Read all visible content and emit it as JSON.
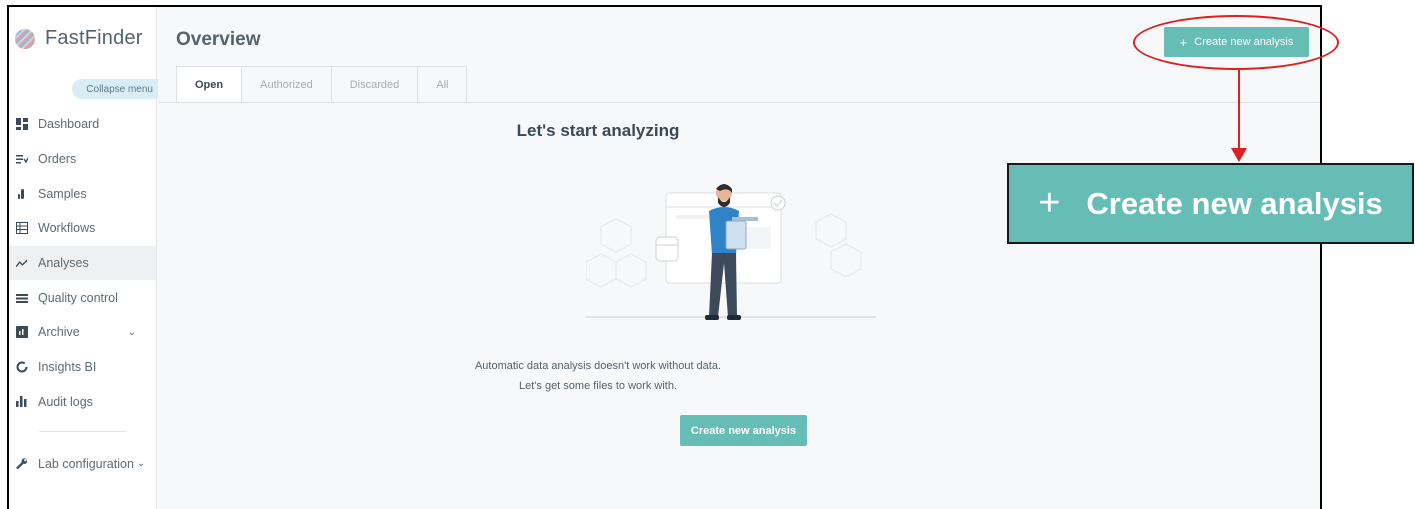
{
  "app": {
    "brand_name": "FastFinder"
  },
  "sidebar": {
    "collapse_label": "Collapse menu",
    "items": [
      {
        "label": "Dashboard",
        "icon": "dashboard-grid-icon"
      },
      {
        "label": "Orders",
        "icon": "orders-list-icon"
      },
      {
        "label": "Samples",
        "icon": "samples-tube-icon"
      },
      {
        "label": "Workflows",
        "icon": "workflows-table-icon"
      },
      {
        "label": "Analyses",
        "icon": "analyses-line-icon",
        "active": true
      },
      {
        "label": "Quality control",
        "icon": "quality-control-icon"
      },
      {
        "label": "Archive",
        "icon": "archive-icon",
        "has_chevron": true
      },
      {
        "label": "Insights BI",
        "icon": "insights-ring-icon"
      },
      {
        "label": "Audit logs",
        "icon": "audit-bar-icon"
      }
    ],
    "lab_config": {
      "label": "Lab configuration",
      "icon": "wrench-icon"
    }
  },
  "header": {
    "title": "Overview",
    "create_button_label": "Create new analysis",
    "create_button_icon": "plus-icon"
  },
  "tabs": [
    {
      "label": "Open",
      "active": true
    },
    {
      "label": "Authorized"
    },
    {
      "label": "Discarded"
    },
    {
      "label": "All"
    }
  ],
  "empty_state": {
    "title": "Let's start analyzing",
    "line1": "Automatic data analysis doesn't work without data.",
    "line2": "Let's get some files to work with.",
    "button_label": "Create new analysis"
  },
  "callout": {
    "label": "Create new analysis",
    "icon": "plus-icon",
    "annotation_color": "#e02020"
  },
  "colors": {
    "accent": "#66bdb6",
    "sidebar_bg": "#ffffff",
    "content_bg": "#f7f8fa"
  }
}
